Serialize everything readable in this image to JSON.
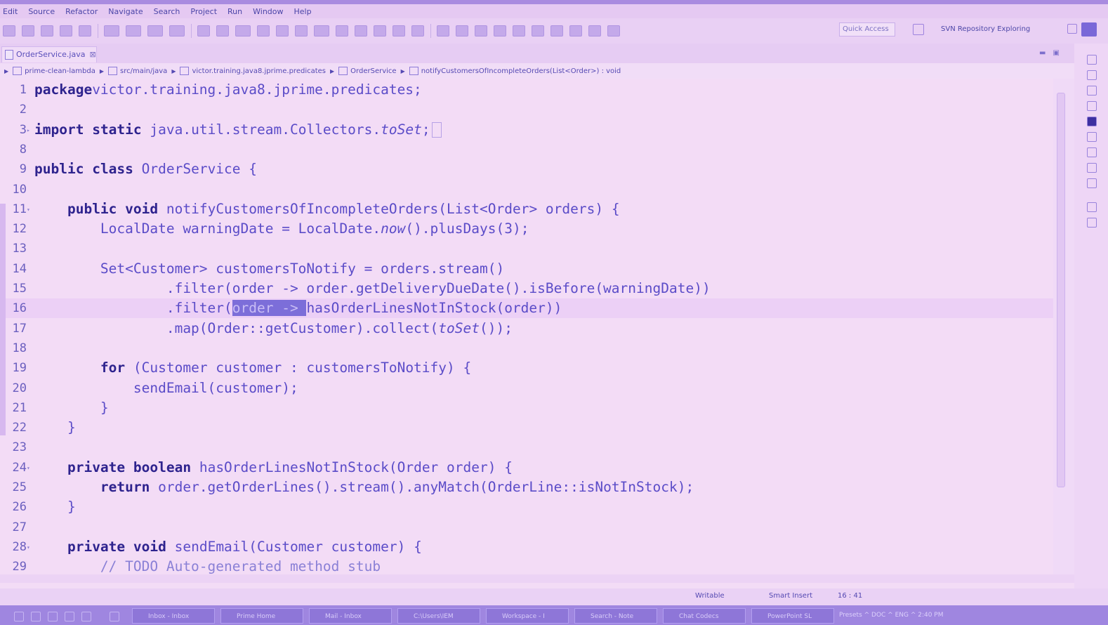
{
  "menu": [
    "Edit",
    "Source",
    "Refactor",
    "Navigate",
    "Search",
    "Project",
    "Run",
    "Window",
    "Help"
  ],
  "toolbar": {
    "quick_access": "Quick Access",
    "perspective": "SVN Repository Exploring"
  },
  "editor_tab": {
    "title": "OrderService.java",
    "close": "⊠"
  },
  "breadcrumb": [
    "prime-clean-lambda",
    "src/main/java",
    "victor.training.java8.jprime.predicates",
    "OrderService",
    "notifyCustomersOfIncompleteOrders(List<Order>) : void"
  ],
  "code_lines": [
    {
      "n": "1",
      "segments": [
        [
          "kw",
          "package"
        ],
        [
          "",
          "victor.training.java8.jprime.predicates;"
        ]
      ]
    },
    {
      "n": "2",
      "segments": []
    },
    {
      "n": "3",
      "fold": "+",
      "segments": [
        [
          "kw",
          "import"
        ],
        [
          "",
          " "
        ],
        [
          "kw",
          "static"
        ],
        [
          "",
          " java.util.stream.Collectors."
        ],
        [
          "it",
          "toSet"
        ],
        [
          "",
          ";"
        ]
      ]
    },
    {
      "n": "8",
      "segments": []
    },
    {
      "n": "9",
      "segments": [
        [
          "kw",
          "public"
        ],
        [
          "",
          " "
        ],
        [
          "kw",
          "class"
        ],
        [
          "",
          " OrderService {"
        ]
      ]
    },
    {
      "n": "10",
      "segments": []
    },
    {
      "n": "11",
      "fold": "-",
      "segments": [
        [
          "",
          "    "
        ],
        [
          "kw",
          "public"
        ],
        [
          "",
          " "
        ],
        [
          "kw",
          "void"
        ],
        [
          "",
          " notifyCustomersOfIncompleteOrders(List<Order> orders) {"
        ]
      ]
    },
    {
      "n": "12",
      "segments": [
        [
          "",
          "        LocalDate warningDate = LocalDate."
        ],
        [
          "it",
          "now"
        ],
        [
          "",
          "().plusDays(3);"
        ]
      ]
    },
    {
      "n": "13",
      "segments": []
    },
    {
      "n": "14",
      "segments": [
        [
          "",
          "        Set<Customer> customersToNotify = orders.stream()"
        ]
      ]
    },
    {
      "n": "15",
      "segments": [
        [
          "",
          "                .filter(order -> order.getDeliveryDueDate().isBefore(warningDate))"
        ]
      ]
    },
    {
      "n": "16",
      "current": true,
      "segments": [
        [
          "",
          "                .filter("
        ],
        [
          "sel",
          "order -> "
        ],
        [
          "",
          "hasOrderLinesNotInStock(order))"
        ]
      ]
    },
    {
      "n": "17",
      "segments": [
        [
          "",
          "                .map(Order::getCustomer).collect("
        ],
        [
          "it",
          "toSet"
        ],
        [
          "",
          "());"
        ]
      ]
    },
    {
      "n": "18",
      "segments": []
    },
    {
      "n": "19",
      "segments": [
        [
          "",
          "        "
        ],
        [
          "kw",
          "for"
        ],
        [
          "",
          " (Customer customer : customersToNotify) {"
        ]
      ]
    },
    {
      "n": "20",
      "segments": [
        [
          "",
          "            sendEmail(customer);"
        ]
      ]
    },
    {
      "n": "21",
      "segments": [
        [
          "",
          "        }"
        ]
      ]
    },
    {
      "n": "22",
      "segments": [
        [
          "",
          "    }"
        ]
      ]
    },
    {
      "n": "23",
      "segments": []
    },
    {
      "n": "24",
      "fold": "-",
      "segments": [
        [
          "",
          "    "
        ],
        [
          "kw",
          "private"
        ],
        [
          "",
          " "
        ],
        [
          "kw",
          "boolean"
        ],
        [
          "",
          " hasOrderLinesNotInStock(Order order) {"
        ]
      ]
    },
    {
      "n": "25",
      "segments": [
        [
          "",
          "        "
        ],
        [
          "kw",
          "return"
        ],
        [
          "",
          " order.getOrderLines().stream().anyMatch(OrderLine::isNotInStock);"
        ]
      ]
    },
    {
      "n": "26",
      "segments": [
        [
          "",
          "    }"
        ]
      ]
    },
    {
      "n": "27",
      "segments": []
    },
    {
      "n": "28",
      "fold": "-",
      "segments": [
        [
          "",
          "    "
        ],
        [
          "kw",
          "private"
        ],
        [
          "",
          " "
        ],
        [
          "kw",
          "void"
        ],
        [
          "",
          " sendEmail(Customer customer) {"
        ]
      ]
    },
    {
      "n": "29",
      "segments": [
        [
          "",
          "        "
        ],
        [
          "cm",
          "// TODO Auto-generated method stub"
        ]
      ]
    }
  ],
  "status": {
    "writable": "Writable",
    "insert_mode": "Smart Insert",
    "position": "16 : 41"
  },
  "taskbar": [
    "Inbox - Inbox",
    "Prime Home",
    "Mail - Inbox",
    "C:\\Users\\IEM",
    "Workspace - I",
    "Search - Note",
    "Chat Codecs",
    "PowerPoint SL"
  ],
  "tray": "Presets  ^  DOC  ^  ENG  ^  2:40 PM"
}
